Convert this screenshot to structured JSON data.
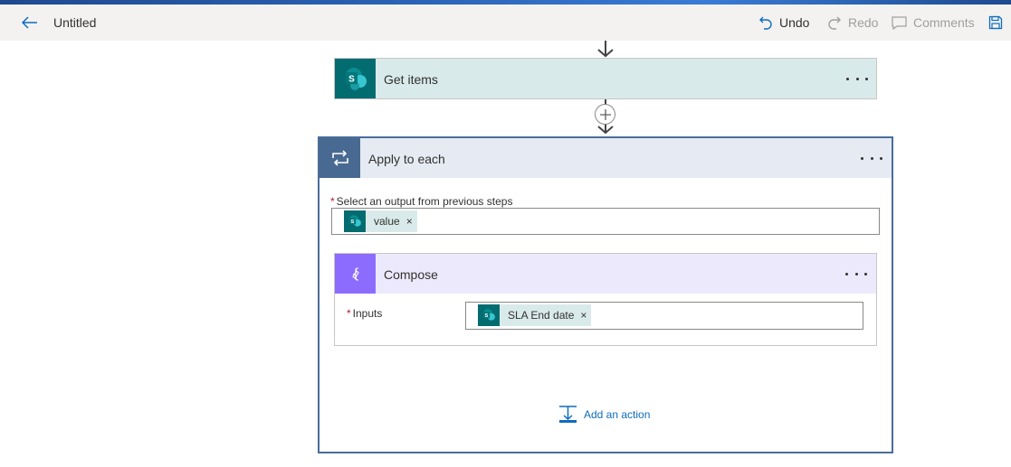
{
  "header": {
    "title": "Untitled",
    "undo_label": "Undo",
    "redo_label": "Redo",
    "comments_label": "Comments"
  },
  "steps": {
    "get_items": {
      "title": "Get items",
      "icon": "sharepoint-icon"
    },
    "apply_to_each": {
      "title": "Apply to each",
      "field_label": "Select an output from previous steps",
      "token_label": "value"
    },
    "compose": {
      "title": "Compose",
      "field_label": "Inputs",
      "token_label": "SLA End date"
    }
  },
  "add_action_label": "Add an action",
  "colors": {
    "sharepoint": "#036c70",
    "loop": "#486991",
    "compose": "#8c6cff",
    "link": "#0f6cbd",
    "required": "#a4262c"
  }
}
